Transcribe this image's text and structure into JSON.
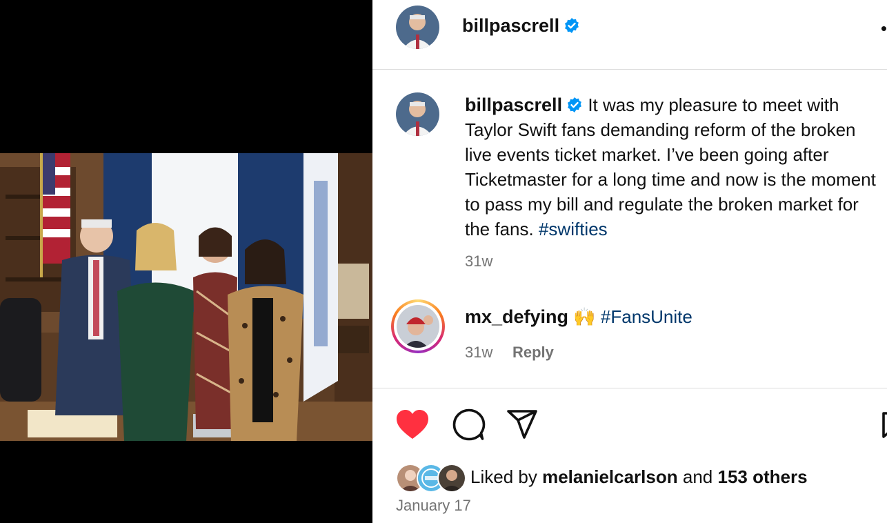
{
  "post": {
    "author": "billpascrell",
    "verified": true,
    "more_icon": "more-options-icon",
    "caption": {
      "text": "It was my pleasure to meet with Taylor Swift fans demanding reform of the broken live events ticket market. I’ve been going after Ticketmaster for a long time and now is the moment to pass my bill and regulate the broken market for the fans.",
      "hashtag": "#swifties",
      "time": "31w"
    },
    "comment": {
      "user": "mx_defying",
      "emoji": "🙌",
      "hashtag": "#FansUnite",
      "time": "31w",
      "reply_label": "Reply"
    },
    "actions": {
      "like_icon": "heart-filled-icon",
      "comment_icon": "comment-bubble-icon",
      "share_icon": "paper-plane-icon",
      "save_icon": "bookmark-icon"
    },
    "likes": {
      "prefix": "Liked by",
      "user": "melanielcarlson",
      "and": "and",
      "others": "153 others"
    },
    "date": "January 17"
  },
  "colors": {
    "like_red": "#ff3040",
    "verified_blue": "#0095f6",
    "hashtag_blue": "#00376b",
    "meta_gray": "#737373"
  }
}
